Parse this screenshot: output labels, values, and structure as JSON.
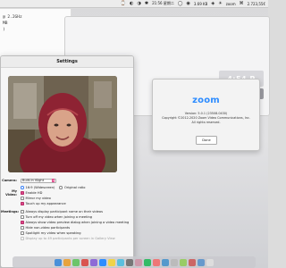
{
  "menubar": {
    "items": [
      "⌚",
      "◐",
      "◑",
      "✱",
      "21:56 星期二",
      "◯",
      "◉",
      "3.69 KB",
      "◈",
      "☀",
      "zoom",
      "⌘",
      "2.723,55€"
    ]
  },
  "terminal": {
    "lines": [
      "@ 2.2GHz",
      "",
      "MB",
      ")"
    ]
  },
  "background_window": {
    "time_text": "4:54 P"
  },
  "settings": {
    "title": "Settings",
    "camera_label": "Camera:",
    "camera_value": "Built-in iSight",
    "video_ratio_169": "16:9 (Widescreen)",
    "video_ratio_orig": "Original ratio",
    "my_video_label": "My Video:",
    "enable_hd": "Enable HD",
    "mirror": "Mirror my video",
    "touch_up": "Touch up my appearance",
    "meetings_label": "Meetings:",
    "always_display_names": "Always display participant name on their videos",
    "turn_off_video": "Turn off my video when joining a meeting",
    "always_show_preview": "Always show video preview dialog when joining a video meeting",
    "hide_non_video": "Hide non-video participants",
    "spotlight": "Spotlight my video when speaking",
    "display_up_to": "Display up to 49 participants per screen in Gallery View"
  },
  "about": {
    "logo": "zoom",
    "version": "Version: 5.0.1 (23508.0430)",
    "copyright_1": "Copyright ©2012-2020 Zoom Video Communications, Inc.",
    "copyright_2": "All rights reserved.",
    "done": "Done"
  }
}
